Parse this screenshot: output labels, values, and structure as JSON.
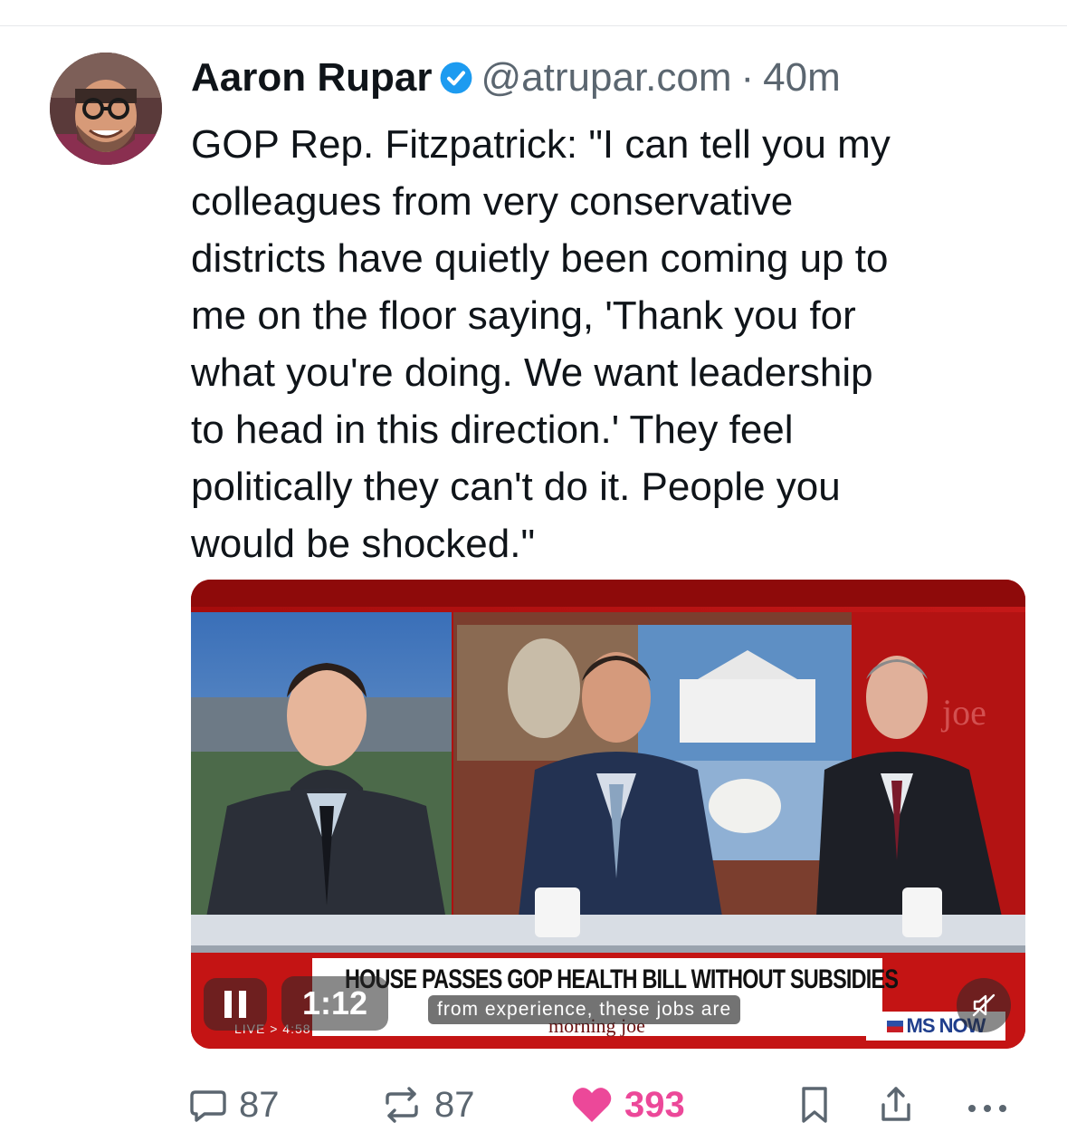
{
  "post": {
    "author_name": "Aaron Rupar",
    "handle": "@atrupar.com",
    "separator": "·",
    "time_ago": "40m",
    "text": "GOP Rep. Fitzpatrick: \"I can tell you my\ncolleagues from very conservative\ndistricts have quietly been coming up to\nme on the floor saying, 'Thank you for\nwhat you're doing. We want leadership\nto head in this direction.' They feel\npolitically they can't do it. People you\nwould be shocked.\""
  },
  "video": {
    "chyron": "HOUSE PASSES GOP HEALTH BILL WITHOUT SUBSIDIES",
    "show_name": "morning joe",
    "network": "MS NOW",
    "live_label": "LIVE > 4:58",
    "elapsed_time": "1:12",
    "caption": "from experience, these jobs are",
    "mug_text": "MS NOW",
    "backdrop_text": "morning joe"
  },
  "actions": {
    "replies": "87",
    "reposts": "87",
    "likes": "393"
  },
  "colors": {
    "verified": "#1d9bf0",
    "like": "#ec4899",
    "muted_text": "#5b6670",
    "chyron_bar": "#c41414"
  },
  "icons": [
    "verified-badge-icon",
    "pause-icon",
    "mute-icon",
    "reply-icon",
    "repost-icon",
    "heart-icon",
    "bookmark-icon",
    "share-icon",
    "more-icon"
  ]
}
